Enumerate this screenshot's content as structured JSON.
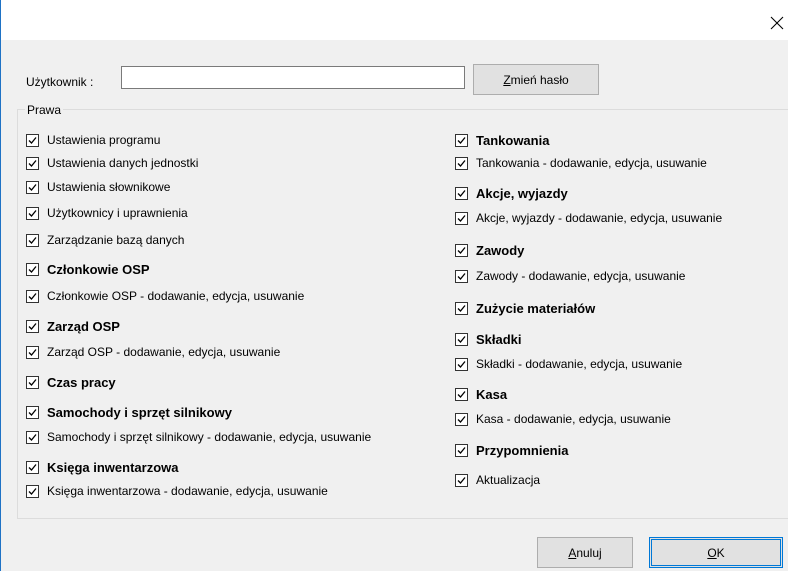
{
  "dialog": {
    "close_glyph": "✕"
  },
  "user": {
    "label": "Użytkownik :",
    "value": "",
    "change_password_prefix": "Z",
    "change_password_rest": "mień hasło"
  },
  "rights": {
    "group_label": "Prawa",
    "left": [
      {
        "label": "Ustawienia programu",
        "checked": true,
        "bold": false
      },
      {
        "label": "Ustawienia danych jednostki",
        "checked": true,
        "bold": false
      },
      {
        "label": "Ustawienia słownikowe",
        "checked": true,
        "bold": false
      },
      {
        "label": "Użytkownicy i uprawnienia",
        "checked": true,
        "bold": false
      },
      {
        "label": "Zarządzanie bazą danych",
        "checked": true,
        "bold": false
      },
      {
        "label": "Członkowie OSP",
        "checked": true,
        "bold": true
      },
      {
        "label": "Członkowie OSP - dodawanie, edycja, usuwanie",
        "checked": true,
        "bold": false
      },
      {
        "label": "Zarząd OSP",
        "checked": true,
        "bold": true
      },
      {
        "label": "Zarząd OSP - dodawanie, edycja, usuwanie",
        "checked": true,
        "bold": false
      },
      {
        "label": "Czas pracy",
        "checked": true,
        "bold": true
      },
      {
        "label": "Samochody i sprzęt silnikowy",
        "checked": true,
        "bold": true
      },
      {
        "label": "Samochody i sprzęt silnikowy - dodawanie, edycja, usuwanie",
        "checked": true,
        "bold": false
      },
      {
        "label": "Księga inwentarzowa",
        "checked": true,
        "bold": true
      },
      {
        "label": "Księga inwentarzowa - dodawanie, edycja, usuwanie",
        "checked": true,
        "bold": false
      }
    ],
    "right": [
      {
        "label": "Tankowania",
        "checked": true,
        "bold": true
      },
      {
        "label": "Tankowania - dodawanie, edycja, usuwanie",
        "checked": true,
        "bold": false
      },
      {
        "label": "Akcje, wyjazdy",
        "checked": true,
        "bold": true
      },
      {
        "label": "Akcje, wyjazdy - dodawanie, edycja, usuwanie",
        "checked": true,
        "bold": false
      },
      {
        "label": "Zawody",
        "checked": true,
        "bold": true
      },
      {
        "label": "Zawody - dodawanie, edycja, usuwanie",
        "checked": true,
        "bold": false
      },
      {
        "label": "Zużycie materiałów",
        "checked": true,
        "bold": true
      },
      {
        "label": "Składki",
        "checked": true,
        "bold": true
      },
      {
        "label": "Składki - dodawanie, edycja, usuwanie",
        "checked": true,
        "bold": false
      },
      {
        "label": "Kasa",
        "checked": true,
        "bold": true
      },
      {
        "label": "Kasa - dodawanie, edycja, usuwanie",
        "checked": true,
        "bold": false
      },
      {
        "label": "Przypomnienia",
        "checked": true,
        "bold": true
      },
      {
        "label": "Aktualizacja",
        "checked": true,
        "bold": false
      }
    ]
  },
  "buttons": {
    "cancel_prefix": "A",
    "cancel_rest": "nuluj",
    "ok_prefix": "O",
    "ok_rest": "K"
  }
}
